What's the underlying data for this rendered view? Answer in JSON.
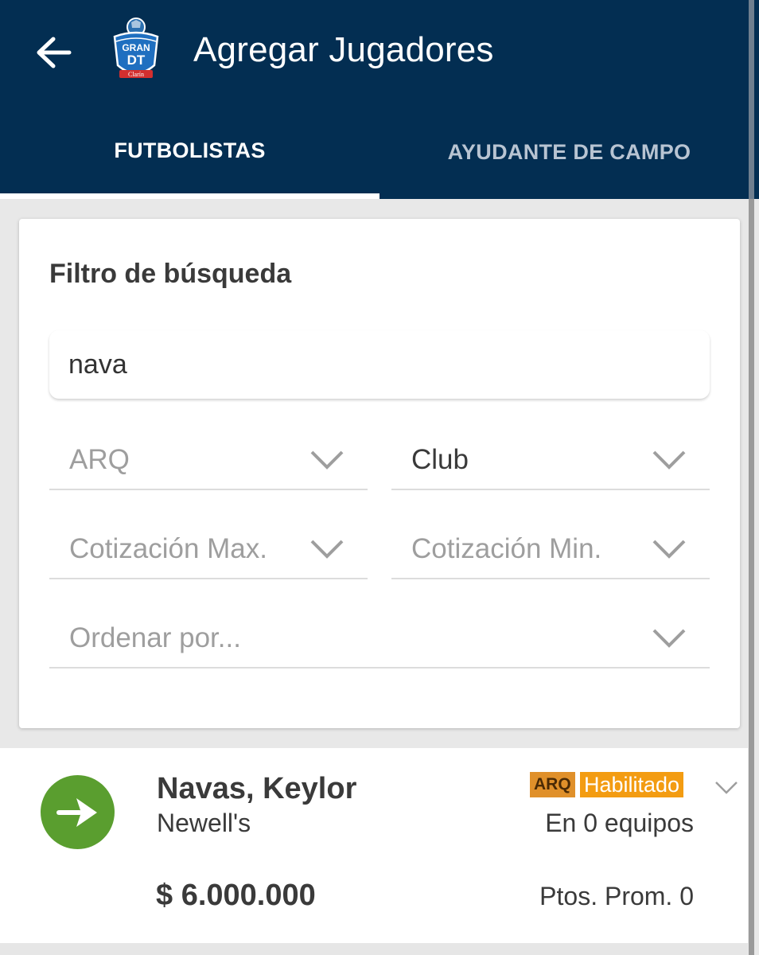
{
  "header": {
    "title": "Agregar Jugadores",
    "back_icon": "arrow-left-icon",
    "logo_text_top": "GRAN",
    "logo_text_bottom": "DT",
    "logo_brand": "Clarín",
    "bg_color": "#032e52"
  },
  "tabs": [
    {
      "label": "FUTBOLISTAS",
      "active": true
    },
    {
      "label": "AYUDANTE DE CAMPO",
      "active": false
    }
  ],
  "filter": {
    "title": "Filtro de búsqueda",
    "search_value": "nava",
    "position_select": "ARQ",
    "club_select": "Club",
    "max_price_select": "Cotización Max.",
    "min_price_select": "Cotización Min.",
    "order_select": "Ordenar por..."
  },
  "player": {
    "name": "Navas, Keylor",
    "club": "Newell's",
    "position_badge": "ARQ",
    "status_badge": "Habilitado",
    "teams": "En 0 equipos",
    "price": "$ 6.000.000",
    "avg_points": "Ptos. Prom. 0",
    "action_color": "#5a9e2f",
    "status_color": "#f39c12"
  }
}
